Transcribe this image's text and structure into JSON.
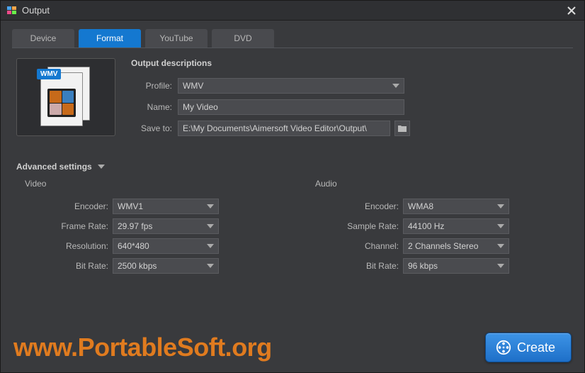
{
  "window": {
    "title": "Output"
  },
  "tabs": [
    {
      "label": "Device"
    },
    {
      "label": "Format"
    },
    {
      "label": "YouTube"
    },
    {
      "label": "DVD"
    }
  ],
  "activeTab": 1,
  "thumb": {
    "badge": "WMV"
  },
  "descriptions": {
    "heading": "Output descriptions",
    "profile_label": "Profile:",
    "profile_value": "WMV",
    "name_label": "Name:",
    "name_value": "My Video",
    "saveto_label": "Save to:",
    "saveto_value": "E:\\My Documents\\Aimersoft Video Editor\\Output\\"
  },
  "advanced": {
    "heading": "Advanced settings",
    "video": {
      "title": "Video",
      "encoder_label": "Encoder:",
      "encoder_value": "WMV1",
      "framerate_label": "Frame Rate:",
      "framerate_value": "29.97 fps",
      "resolution_label": "Resolution:",
      "resolution_value": "640*480",
      "bitrate_label": "Bit Rate:",
      "bitrate_value": "2500 kbps"
    },
    "audio": {
      "title": "Audio",
      "encoder_label": "Encoder:",
      "encoder_value": "WMA8",
      "samplerate_label": "Sample Rate:",
      "samplerate_value": "44100 Hz",
      "channel_label": "Channel:",
      "channel_value": "2 Channels Stereo",
      "bitrate_label": "Bit Rate:",
      "bitrate_value": "96 kbps"
    }
  },
  "footer": {
    "watermark": "www.PortableSoft.org",
    "create_label": "Create"
  }
}
